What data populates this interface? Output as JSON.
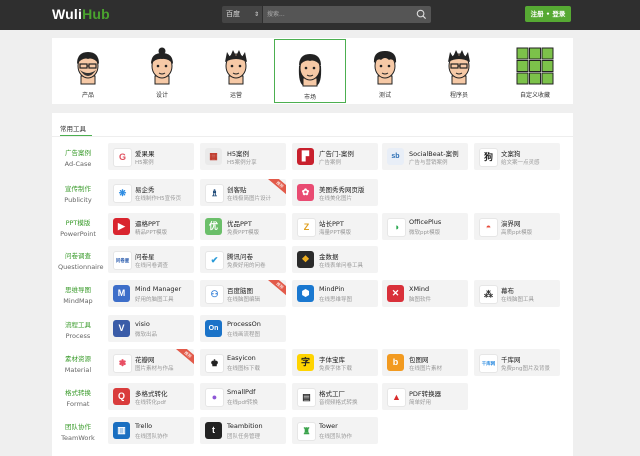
{
  "header": {
    "logo_main": "Wuli",
    "logo_accent": "Hub",
    "engine": "百度",
    "search_placeholder": "搜索...",
    "login_label": "注册 • 登录"
  },
  "roles": [
    {
      "label": "产品"
    },
    {
      "label": "设计"
    },
    {
      "label": "运营"
    },
    {
      "label": "市场",
      "selected": true
    },
    {
      "label": "测试"
    },
    {
      "label": "程序员"
    },
    {
      "label": "自定义收藏"
    }
  ],
  "section_tab": "常用工具",
  "categories": [
    {
      "cn": "广告案例",
      "en": "Ad-Case"
    },
    {
      "cn": "宣传制作",
      "en": "Publicity"
    },
    {
      "cn": "PPT模版",
      "en": "PowerPoint"
    },
    {
      "cn": "问卷调查",
      "en": "Questionnaire"
    },
    {
      "cn": "思维导图",
      "en": "MindMap"
    },
    {
      "cn": "流程工具",
      "en": "Process"
    },
    {
      "cn": "素材资源",
      "en": "Material"
    },
    {
      "cn": "格式转换",
      "en": "Format"
    },
    {
      "cn": "团队协作",
      "en": "TeamWork"
    }
  ],
  "tools": [
    [
      {
        "name": "爱果果",
        "desc": "H5案例",
        "icon": "G",
        "color": "#ffffff",
        "fg": "#e0505f"
      },
      {
        "name": "H5案例",
        "desc": "H5案例分享",
        "icon": "▦",
        "color": "#eaeaea",
        "fg": "#c0392b"
      },
      {
        "name": "广告门-案例",
        "desc": "广告案例",
        "icon": "▛",
        "color": "#c8202d",
        "fg": "#fff"
      },
      {
        "name": "SocialBeat-案例",
        "desc": "广告与营销案例",
        "icon": "sb",
        "color": "#e8eef7",
        "fg": "#2c6fb5"
      },
      {
        "name": "文案狗",
        "desc": "给文案一点灵感",
        "icon": "狗",
        "color": "#fff",
        "fg": "#222"
      }
    ],
    [
      {
        "name": "易企秀",
        "desc": "在线制作H5宣传页",
        "icon": "❋",
        "color": "#fff",
        "fg": "#2f8de3"
      },
      {
        "name": "创客贴",
        "desc": "在线极简图片设计",
        "icon": "♗",
        "color": "#fff",
        "fg": "#0d3c6e",
        "badge": "推荐"
      },
      {
        "name": "美图秀秀网页版",
        "desc": "在线美化图片",
        "icon": "✿",
        "color": "#e94b72",
        "fg": "#fff"
      }
    ],
    [
      {
        "name": "逼格PPT",
        "desc": "精品PPT模版",
        "icon": "▶",
        "color": "#d9242e",
        "fg": "#fff"
      },
      {
        "name": "优品PPT",
        "desc": "免费PPT模版",
        "icon": "优",
        "color": "#6bbf6a",
        "fg": "#fff"
      },
      {
        "name": "站长PPT",
        "desc": "海量PPT模版",
        "icon": "Z",
        "color": "#fff",
        "fg": "#e0a020"
      },
      {
        "name": "OfficePlus",
        "desc": "微软ppt模版",
        "icon": "◑",
        "color": "#fff",
        "fg": "#2aa84f"
      },
      {
        "name": "演界网",
        "desc": "高质ppt模版",
        "icon": "◓",
        "color": "#fff",
        "fg": "#e74c3c"
      }
    ],
    [
      {
        "name": "问卷星",
        "desc": "在线问卷调查",
        "icon": "问卷星",
        "color": "#fff",
        "fg": "#2255aa"
      },
      {
        "name": "腾讯问卷",
        "desc": "免费好用的问卷",
        "icon": "✔",
        "color": "#fff",
        "fg": "#2b9bd8"
      },
      {
        "name": "金数据",
        "desc": "在线表单问卷工具",
        "icon": "❖",
        "color": "#2a2a2a",
        "fg": "#f0b020"
      }
    ],
    [
      {
        "name": "Mind Manager",
        "desc": "好用的脑图工具",
        "icon": "M",
        "color": "#3d6ec9",
        "fg": "#fff"
      },
      {
        "name": "百度脑图",
        "desc": "在线脑图编辑",
        "icon": "⚇",
        "color": "#fff",
        "fg": "#2c7ad6",
        "badge": "推荐"
      },
      {
        "name": "MindPin",
        "desc": "在线思维导图",
        "icon": "⬢",
        "color": "#1a78d0",
        "fg": "#fff"
      },
      {
        "name": "XMind",
        "desc": "脑图软件",
        "icon": "✕",
        "color": "#d9303a",
        "fg": "#fff"
      },
      {
        "name": "幕布",
        "desc": "在线脑图工具",
        "icon": "⁂",
        "color": "#fff",
        "fg": "#333"
      }
    ],
    [
      {
        "name": "visio",
        "desc": "微软出品",
        "icon": "V",
        "color": "#3a5ca8",
        "fg": "#fff"
      },
      {
        "name": "ProcessOn",
        "desc": "在线画流程图",
        "icon": "On",
        "color": "#1b73c8",
        "fg": "#fff"
      }
    ],
    [
      {
        "name": "花瓣网",
        "desc": "图片素材与作品",
        "icon": "✽",
        "color": "#fff",
        "fg": "#e84e63",
        "badge": "推荐"
      },
      {
        "name": "Easyicon",
        "desc": "在线图标下载",
        "icon": "♚",
        "color": "#fff",
        "fg": "#222"
      },
      {
        "name": "字体宝库",
        "desc": "免费字体下载",
        "icon": "字",
        "color": "#ffd400",
        "fg": "#222"
      },
      {
        "name": "包图网",
        "desc": "在线图片素材",
        "icon": "b",
        "color": "#f29a20",
        "fg": "#fff"
      },
      {
        "name": "千库网",
        "desc": "免费png图片及背景",
        "icon": "千库网",
        "color": "#fff",
        "fg": "#2d8ce0"
      }
    ],
    [
      {
        "name": "多格式转化",
        "desc": "在线转化pdf",
        "icon": "Q",
        "color": "#d93c3c",
        "fg": "#fff"
      },
      {
        "name": "SmallPdf",
        "desc": "在线pdf转换",
        "icon": "●",
        "color": "#fff",
        "fg": "#8e57d6"
      },
      {
        "name": "格式工厂",
        "desc": "音视频格式转换",
        "icon": "▤",
        "color": "#fff",
        "fg": "#333"
      },
      {
        "name": "PDF转换器",
        "desc": "简单好用",
        "icon": "▲",
        "color": "#fff",
        "fg": "#d92b2b"
      }
    ],
    [
      {
        "name": "Trello",
        "desc": "在线团队协作",
        "icon": "▥",
        "color": "#1a6fc1",
        "fg": "#fff"
      },
      {
        "name": "Teambition",
        "desc": "团队任务管理",
        "icon": "t",
        "color": "#222",
        "fg": "#fff"
      },
      {
        "name": "Tower",
        "desc": "在线团队协作",
        "icon": "♜",
        "color": "#fff",
        "fg": "#3aa34b"
      }
    ]
  ]
}
